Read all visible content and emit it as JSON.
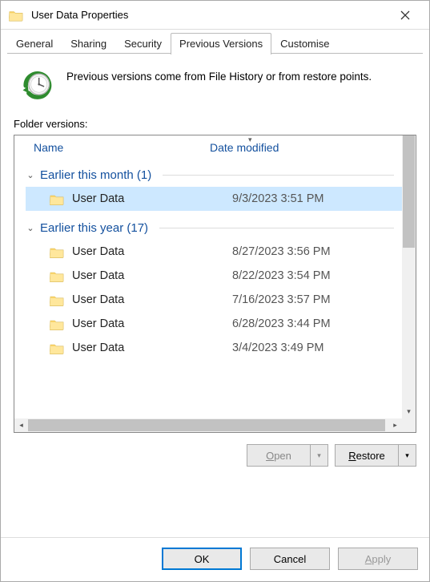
{
  "window": {
    "title": "User Data Properties"
  },
  "tabs": {
    "general": "General",
    "sharing": "Sharing",
    "security": "Security",
    "previous_versions": "Previous Versions",
    "customise": "Customise",
    "active": "previous_versions"
  },
  "intro": {
    "text": "Previous versions come from File History or from restore points."
  },
  "section": {
    "label": "Folder versions:"
  },
  "columns": {
    "name": "Name",
    "date": "Date modified"
  },
  "groups": [
    {
      "label": "Earlier this month (1)",
      "items": [
        {
          "name": "User Data",
          "date": "9/3/2023 3:51 PM",
          "selected": true
        }
      ]
    },
    {
      "label": "Earlier this year (17)",
      "items": [
        {
          "name": "User Data",
          "date": "8/27/2023 3:56 PM",
          "selected": false
        },
        {
          "name": "User Data",
          "date": "8/22/2023 3:54 PM",
          "selected": false
        },
        {
          "name": "User Data",
          "date": "7/16/2023 3:57 PM",
          "selected": false
        },
        {
          "name": "User Data",
          "date": "6/28/2023 3:44 PM",
          "selected": false
        },
        {
          "name": "User Data",
          "date": "3/4/2023 3:49 PM",
          "selected": false
        }
      ]
    }
  ],
  "actions": {
    "open": "Open",
    "restore": "Restore"
  },
  "dialog": {
    "ok": "OK",
    "cancel": "Cancel",
    "apply": "Apply"
  }
}
